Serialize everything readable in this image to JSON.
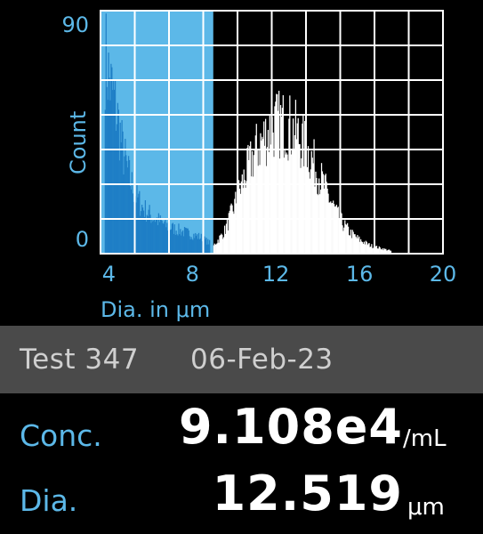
{
  "chart_data": {
    "type": "histogram",
    "xlabel": "Dia. in μm",
    "ylabel": "Count",
    "x_ticks": [
      "4",
      "8",
      "12",
      "16",
      "20"
    ],
    "y_ticks": [
      "0",
      "90"
    ],
    "xlim": [
      3.6,
      20
    ],
    "ylim": [
      0,
      90
    ],
    "gated_region": [
      3.6,
      9.0
    ],
    "grid": true,
    "series": [
      {
        "role": "debris",
        "color": "#1f7fc6",
        "x": [
          3.8,
          4.0,
          4.2,
          4.4,
          4.6,
          4.8,
          5.0,
          5.3,
          5.6,
          6.0,
          6.4,
          6.8,
          7.2,
          7.6,
          8.0,
          8.4,
          8.8
        ],
        "y": [
          74,
          64,
          58,
          50,
          40,
          33,
          27,
          21,
          17,
          14,
          12,
          10,
          9,
          8,
          7,
          6,
          4
        ]
      },
      {
        "role": "cells",
        "color": "#ffffff",
        "x": [
          9.0,
          9.5,
          10.0,
          10.5,
          11.0,
          11.5,
          12.0,
          12.5,
          13.0,
          13.5,
          14.0,
          14.5,
          15.0,
          15.5,
          16.0,
          16.5,
          17.0,
          17.5
        ],
        "y": [
          3,
          8,
          18,
          29,
          38,
          44,
          48,
          48,
          44,
          38,
          30,
          21,
          13,
          8,
          5,
          3,
          2,
          1
        ]
      }
    ]
  },
  "info": {
    "test_label": "Test 347",
    "date": "06-Feb-23"
  },
  "results": {
    "conc": {
      "label": "Conc.",
      "value": "9.108e4",
      "unit": "/mL"
    },
    "dia": {
      "label": "Dia.",
      "value": "12.519",
      "unit": "μm"
    }
  }
}
